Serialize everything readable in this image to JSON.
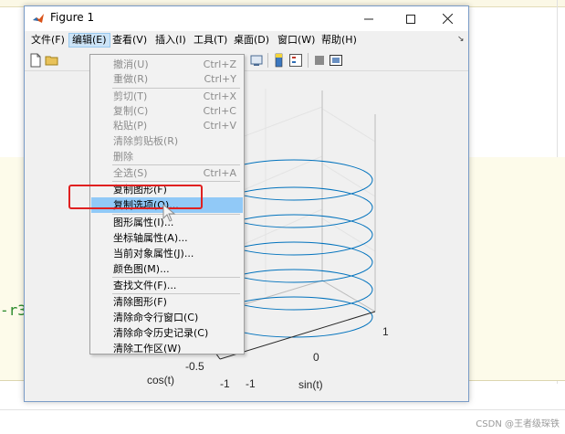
{
  "background": {
    "code_fragment": "-r3",
    "watermark": "CSDN @王者级琛铁"
  },
  "window": {
    "title": "Figure 1",
    "controls": [
      "—",
      "☐",
      "✕"
    ]
  },
  "menubar": {
    "items": [
      {
        "label": "文件(F)"
      },
      {
        "label": "编辑(E)",
        "active": true
      },
      {
        "label": "查看(V)"
      },
      {
        "label": "插入(I)"
      },
      {
        "label": "工具(T)"
      },
      {
        "label": "桌面(D)"
      },
      {
        "label": "窗口(W)"
      },
      {
        "label": "帮助(H)"
      }
    ],
    "dock_arrow": "↘"
  },
  "edit_menu": {
    "items": [
      {
        "label": "撤消(U)",
        "shortcut": "Ctrl+Z",
        "enabled": false
      },
      {
        "label": "重做(R)",
        "shortcut": "Ctrl+Y",
        "enabled": false
      },
      {
        "label": "剪切(T)",
        "shortcut": "Ctrl+X",
        "enabled": false
      },
      {
        "label": "复制(C)",
        "shortcut": "Ctrl+C",
        "enabled": false
      },
      {
        "label": "粘贴(P)",
        "shortcut": "Ctrl+V",
        "enabled": false
      },
      {
        "label": "清除剪贴板(R)",
        "shortcut": "",
        "enabled": false
      },
      {
        "label": "删除",
        "shortcut": "",
        "enabled": false
      },
      {
        "label": "全选(S)",
        "shortcut": "Ctrl+A",
        "enabled": false
      },
      {
        "label": "复制图形(F)",
        "shortcut": "",
        "enabled": true
      },
      {
        "label": "复制选项(O)...",
        "shortcut": "",
        "enabled": true,
        "highlighted": true
      },
      {
        "label": "图形属性(I)...",
        "shortcut": "",
        "enabled": true
      },
      {
        "label": "坐标轴属性(A)...",
        "shortcut": "",
        "enabled": true
      },
      {
        "label": "当前对象属性(J)...",
        "shortcut": "",
        "enabled": true
      },
      {
        "label": "颜色图(M)...",
        "shortcut": "",
        "enabled": true
      },
      {
        "label": "查找文件(F)...",
        "shortcut": "",
        "enabled": true
      },
      {
        "label": "清除图形(F)",
        "shortcut": "",
        "enabled": true
      },
      {
        "label": "清除命令行窗口(C)",
        "shortcut": "",
        "enabled": true
      },
      {
        "label": "清除命令历史记录(C)",
        "shortcut": "",
        "enabled": true
      },
      {
        "label": "清除工作区(W)",
        "shortcut": "",
        "enabled": true
      }
    ]
  },
  "plot": {
    "xlabel": "cos(t)",
    "ylabel": "sin(t)",
    "x_ticks": [
      "-0.5",
      "-1"
    ],
    "y_ticks": [
      "-1",
      "0",
      "1"
    ],
    "line_color": "#0072bd"
  },
  "colors": {
    "accent_highlight": "#91c9f7",
    "annotation_box": "#e02020"
  }
}
